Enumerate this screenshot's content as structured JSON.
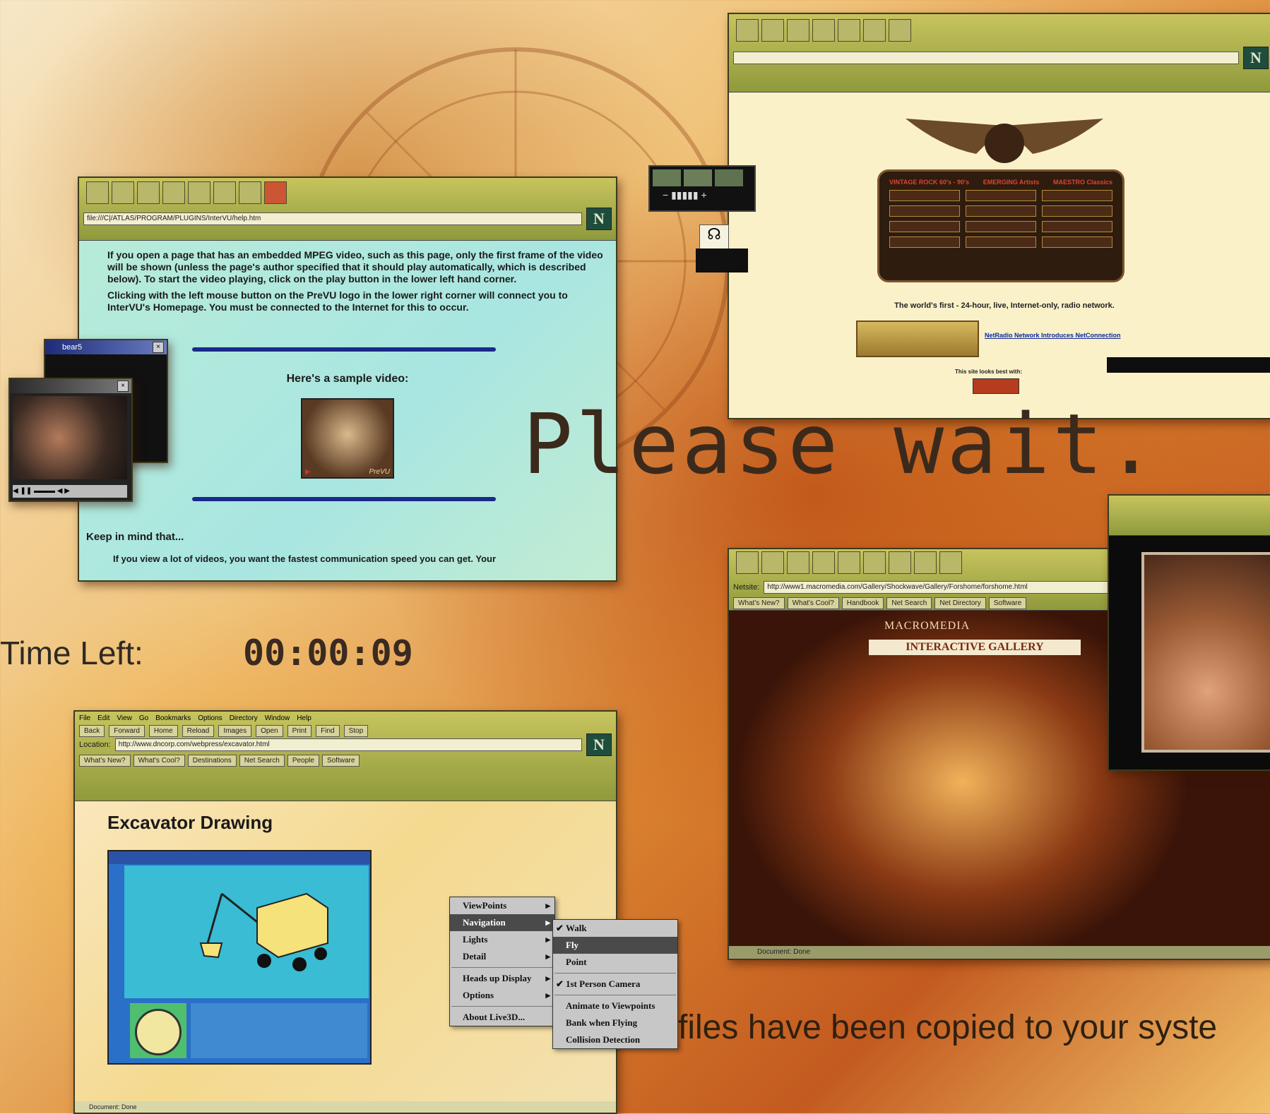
{
  "overlay": {
    "please_wait": "Please wait.",
    "time_left_label": "Time Left:",
    "time_left_value": "00:00:09",
    "files_copied": "files have been copied to your syste"
  },
  "prevu_window": {
    "location": "file:///C|/ATLAS/PROGRAM/PLUGINS/InterVU/help.htm",
    "para1": "If you open a page that has an embedded MPEG video, such as this page, only the first frame of the video will be shown (unless the page's author specified that it should play automatically, which is described below). To start the video playing, click on the play button in the lower left hand corner.",
    "para2": "Clicking with the left mouse button on the PreVU logo in the lower right corner will connect you to InterVU's Homepage. You must be connected to the Internet for this to occur.",
    "sample_heading": "Here's a sample video:",
    "video_logo": "PreVU",
    "keep_in_mind": "Keep in mind that...",
    "bullet": "If you view a lot of videos, you want the fastest communication speed you can get. Your"
  },
  "mini_video": {
    "title": "bear5"
  },
  "radio_window": {
    "col1": "VINTAGE ROCK 60's - 90's",
    "col2": "EMERGING Artists",
    "col3": "MAESTRO Classics",
    "tagline": "The world's first - 24-hour, live, Internet-only, radio network.",
    "link": "NetRadio Network Introduces NetConnection",
    "best_with": "This site looks best with:"
  },
  "macromedia_window": {
    "location_label": "Netsite:",
    "location": "http://www1.macromedia.com/Gallery/Shockwave/Gallery/Forshome/forshome.html",
    "nav": [
      "What's New?",
      "What's Cool?",
      "Handbook",
      "Net Search",
      "Net Directory",
      "Software"
    ],
    "brand": "MACROMEDIA",
    "gallery": "INTERACTIVE GALLERY",
    "status": "Document: Done"
  },
  "excavator_window": {
    "menubar": [
      "File",
      "Edit",
      "View",
      "Go",
      "Bookmarks",
      "Options",
      "Directory",
      "Window",
      "Help"
    ],
    "toolbar": [
      "Back",
      "Forward",
      "Home",
      "Reload",
      "Images",
      "Open",
      "Print",
      "Find",
      "Stop"
    ],
    "location_label": "Location:",
    "location": "http://www.dncorp.com/webpress/excavator.html",
    "nav": [
      "What's New?",
      "What's Cool?",
      "Destinations",
      "Net Search",
      "People",
      "Software"
    ],
    "page_title": "Excavator Drawing",
    "status": "Document: Done"
  },
  "context_menu": {
    "items": [
      "ViewPoints",
      "Navigation",
      "Lights",
      "Detail",
      "Heads up Display",
      "Options",
      "About Live3D..."
    ],
    "submenu": [
      "Walk",
      "Fly",
      "Point",
      "1st Person Camera",
      "Animate to Viewpoints",
      "Bank when Flying",
      "Collision Detection"
    ]
  },
  "colors": {
    "accent_green": "#1e4d3e",
    "cyan_page": "#a8e4d6",
    "navy_rule": "#1a2a8a"
  }
}
